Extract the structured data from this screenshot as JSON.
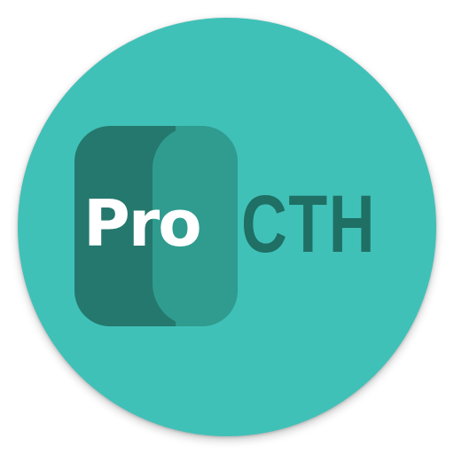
{
  "logo": {
    "word_primary": "Pro",
    "word_secondary": "CTH"
  },
  "colors": {
    "circle_background": "#40c1b8",
    "pill_dark": "#25786d",
    "pill_light": "#2f9c8f",
    "text_primary": "#ffffff",
    "text_secondary": "#1f6f64"
  }
}
